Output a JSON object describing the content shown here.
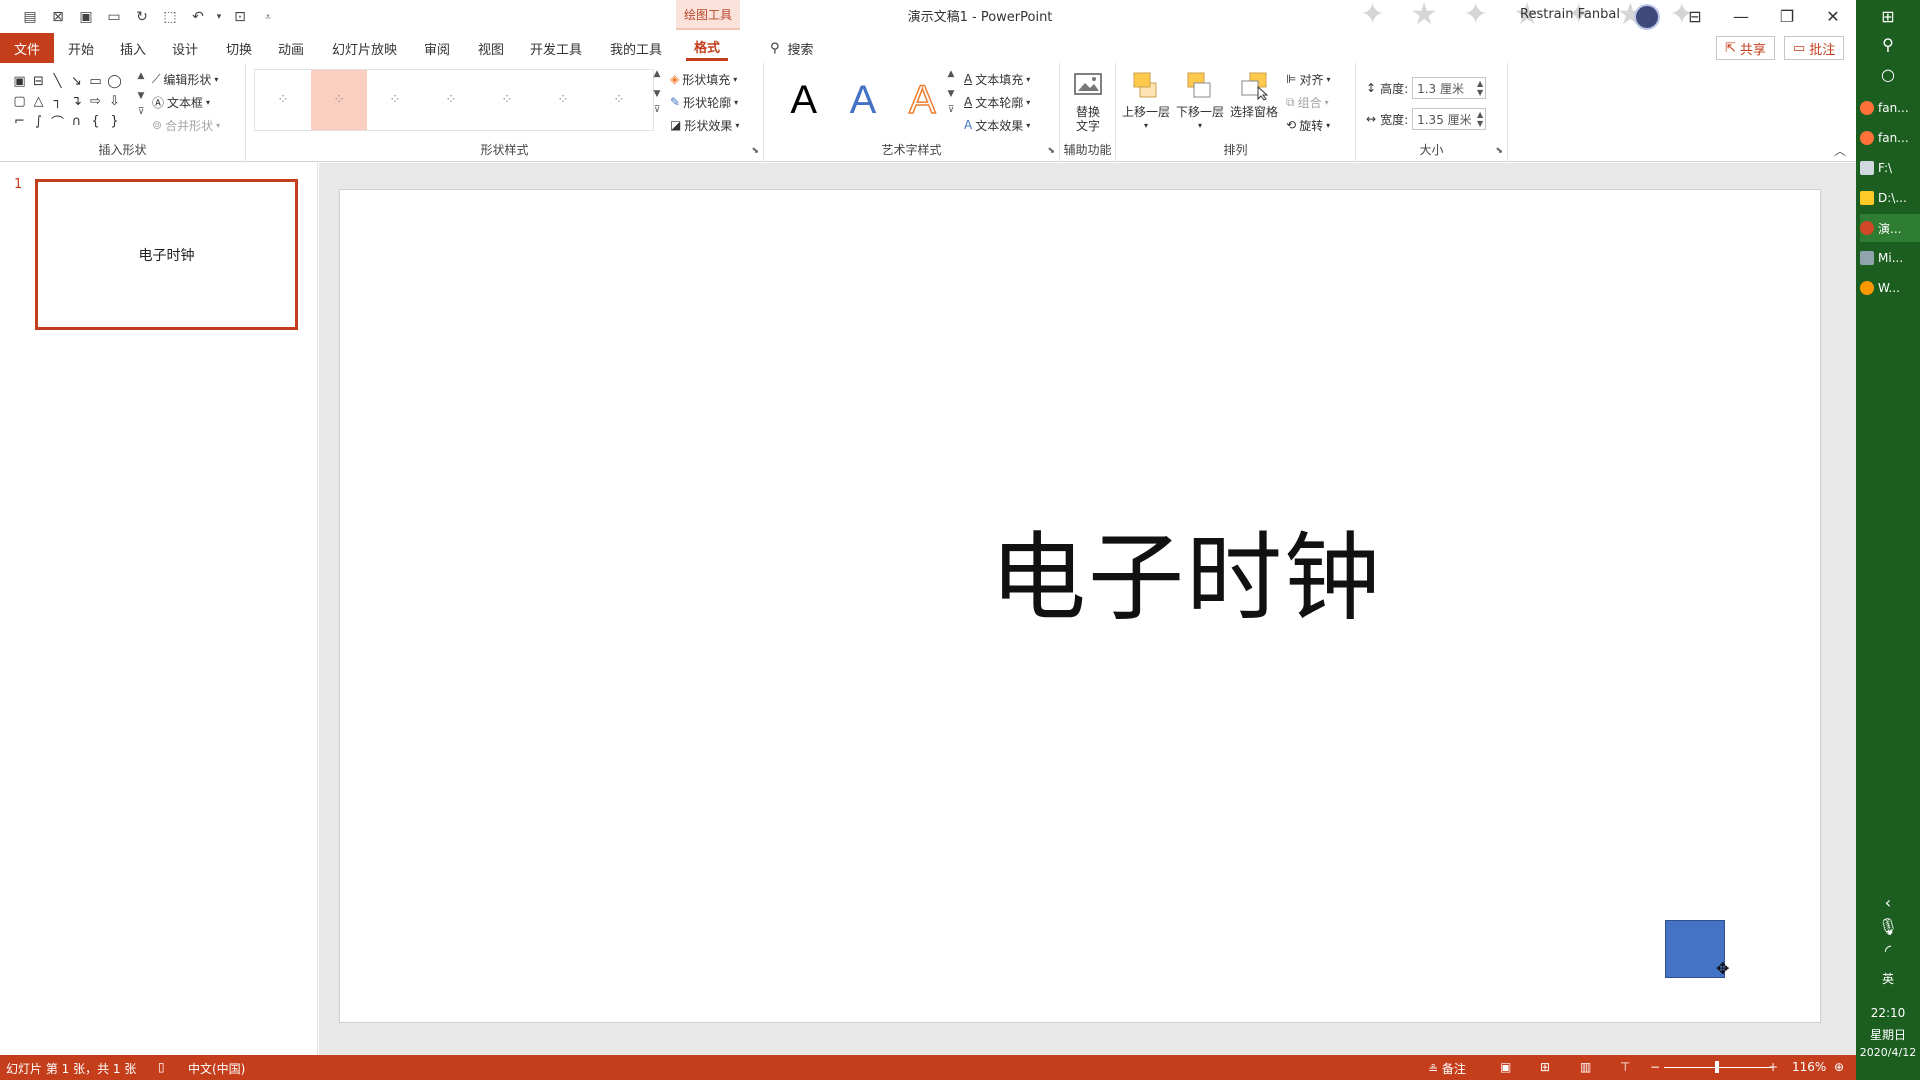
{
  "window": {
    "contextual_tab": "绘图工具",
    "doc_title": "演示文稿1  -  PowerPoint",
    "user_name": "Restrain Fanbal"
  },
  "tabs": [
    "文件",
    "开始",
    "插入",
    "设计",
    "切换",
    "动画",
    "幻灯片放映",
    "审阅",
    "视图",
    "开发工具",
    "我的工具",
    "格式"
  ],
  "search_label": "搜索",
  "share_label": "共享",
  "comment_label": "批注",
  "ribbon": {
    "insert_shapes": {
      "label": "插入形状",
      "edit_shape": "编辑形状",
      "textbox": "文本框",
      "merge_shapes": "合并形状"
    },
    "shape_styles": {
      "label": "形状样式",
      "fill": "形状填充",
      "outline": "形状轮廓",
      "effects": "形状效果"
    },
    "wordart": {
      "label": "艺术字样式",
      "sample": "A",
      "fill": "文本填充",
      "outline": "文本轮廓",
      "effects": "文本效果"
    },
    "accessibility": {
      "label": "辅助功能",
      "alt_text_line1": "替换",
      "alt_text_line2": "文字"
    },
    "arrange": {
      "label": "排列",
      "bring_forward": "上移一层",
      "send_backward": "下移一层",
      "selection_pane": "选择窗格",
      "align": "对齐",
      "group": "组合",
      "rotate": "旋转"
    },
    "size": {
      "label": "大小",
      "height_label": "高度:",
      "height_value": "1.3 厘米",
      "width_label": "宽度:",
      "width_value": "1.35 厘米"
    }
  },
  "thumbnails": [
    {
      "number": "1",
      "title": "电子时钟"
    }
  ],
  "slide": {
    "title": "电子时钟",
    "shape_color": "#4472c4"
  },
  "status": {
    "slide_info": "幻灯片 第 1 张，共 1 张",
    "language": "中文(中国)",
    "notes": "备注",
    "zoom": "116%"
  },
  "taskbar": {
    "apps": [
      "fan...",
      "fan...",
      "F:\\",
      "D:\\...",
      "演...",
      "Mi...",
      "W..."
    ],
    "ime": "英",
    "time": "22:10",
    "weekday": "星期日",
    "date": "2020/4/12"
  },
  "colors": {
    "accent": "#c43e1c",
    "taskbar": "#1b5e20"
  }
}
